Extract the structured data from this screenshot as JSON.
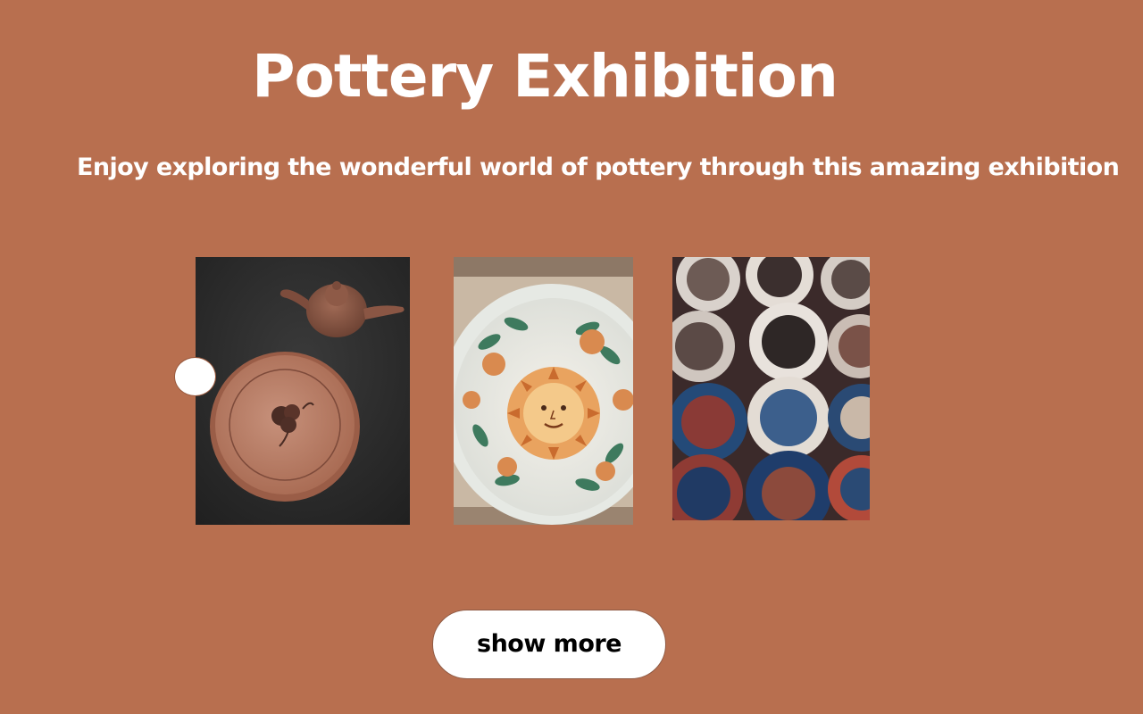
{
  "page": {
    "title": "Pottery Exhibition",
    "subtitle": "Enjoy exploring the wonderful world of pottery through this amazing exhibition",
    "background_color": "#b86f4f"
  },
  "gallery": {
    "photos": [
      {
        "subject": "teapot and clay plate on dark table"
      },
      {
        "subject": "painted ceramic bowl with sun face"
      },
      {
        "subject": "stacked decorative plates with mosque motifs"
      }
    ],
    "prev_control_icon": "circle-dot-icon"
  },
  "actions": {
    "show_more_label": "show more"
  }
}
